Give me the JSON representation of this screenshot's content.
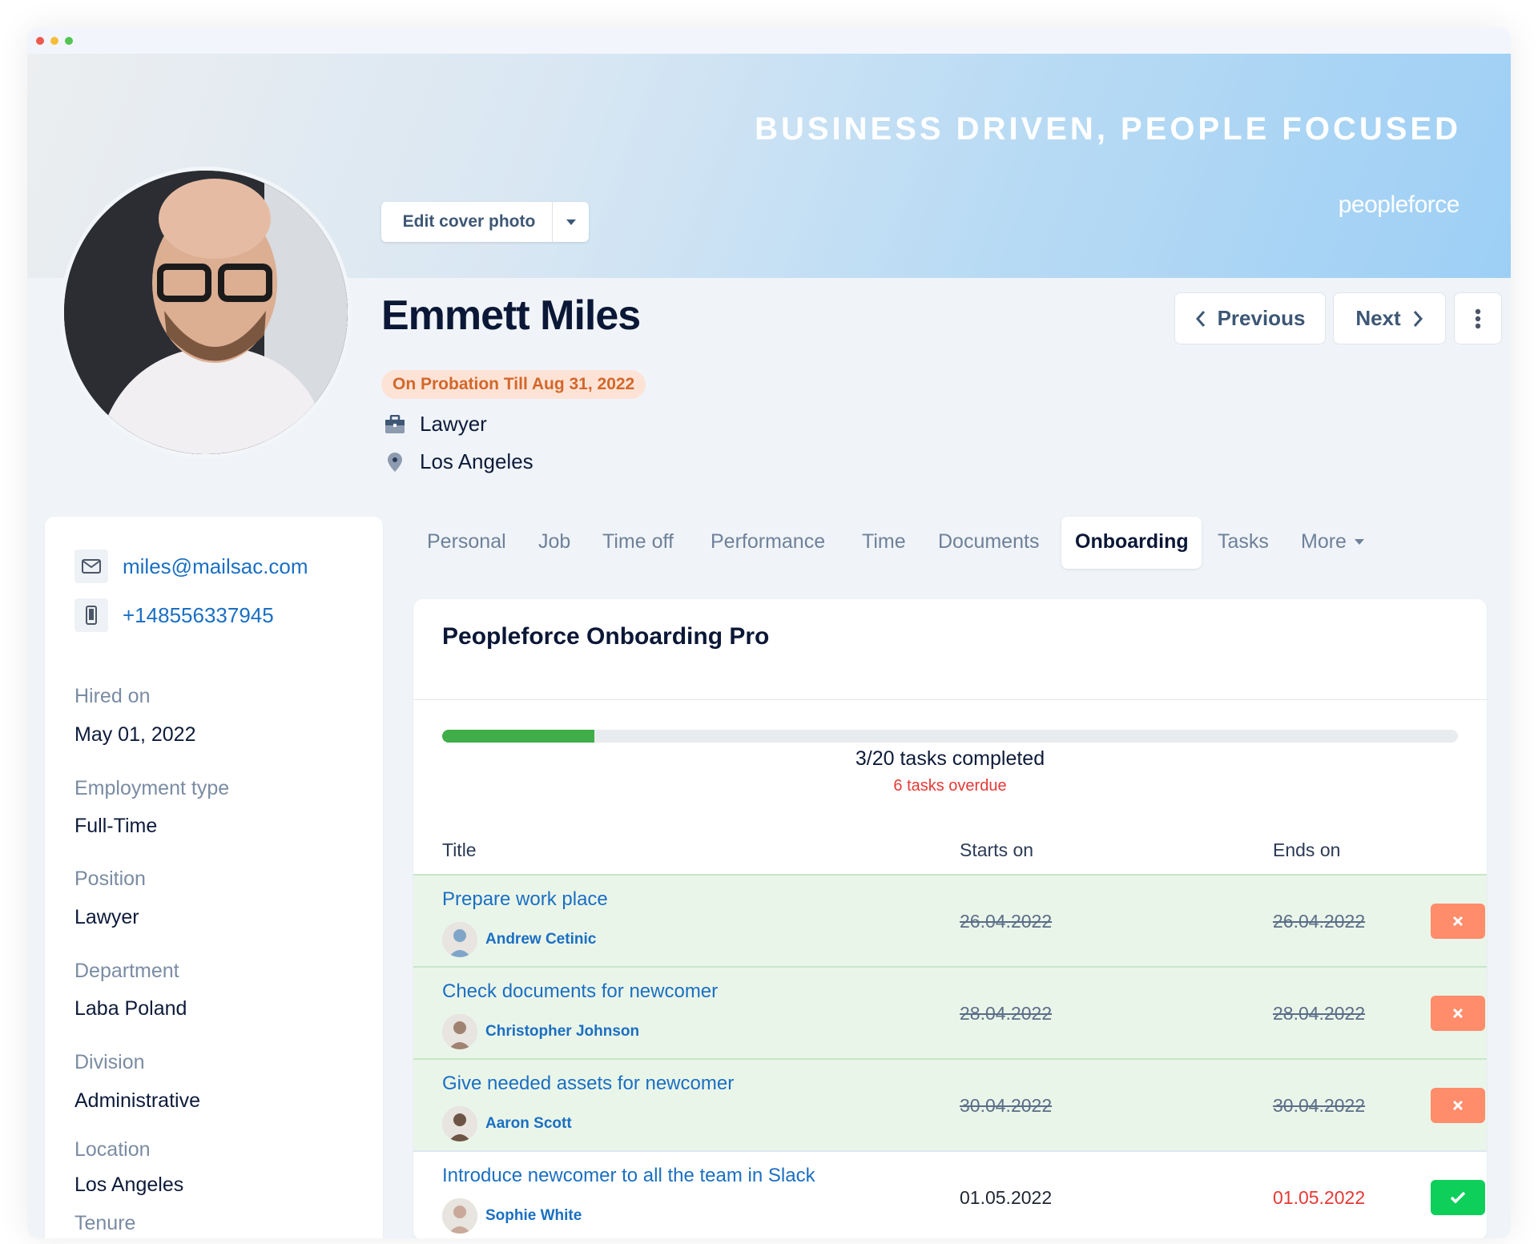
{
  "window": {
    "controls": [
      "close",
      "minimize",
      "maximize"
    ],
    "colors": {
      "close": "#ee5b4e",
      "minimize": "#f5bd3a",
      "maximize": "#54c453"
    }
  },
  "cover": {
    "tagline": "BUSINESS DRIVEN, PEOPLE FOCUSED",
    "logo": "peopleforce",
    "edit_label": "Edit cover photo"
  },
  "profile": {
    "name": "Emmett Miles",
    "status_badge": "On Probation Till Aug 31, 2022",
    "job_title": "Lawyer",
    "location": "Los Angeles"
  },
  "nav": {
    "previous": "Previous",
    "next": "Next"
  },
  "contact": {
    "email": "miles@mailsac.com",
    "phone": "+148556337945"
  },
  "details": [
    {
      "label": "Hired on",
      "value": "May 01, 2022"
    },
    {
      "label": "Employment type",
      "value": "Full-Time"
    },
    {
      "label": "Position",
      "value": "Lawyer"
    },
    {
      "label": "Department",
      "value": "Laba Poland"
    },
    {
      "label": "Division",
      "value": "Administrative"
    },
    {
      "label": "Location",
      "value": "Los Angeles"
    },
    {
      "label": "Tenure",
      "value": ""
    }
  ],
  "tabs": [
    "Personal",
    "Job",
    "Time off",
    "Performance",
    "Time",
    "Documents",
    "Onboarding",
    "Tasks",
    "More"
  ],
  "active_tab": "Onboarding",
  "onboarding": {
    "title": "Peopleforce Onboarding Pro",
    "progress_percent": 15,
    "completed_text": "3/20 tasks completed",
    "overdue_text": "6 tasks overdue",
    "columns": [
      "Title",
      "Starts on",
      "Ends on"
    ],
    "tasks": [
      {
        "title": "Prepare work place",
        "assignee": "Andrew Cetinic",
        "starts": "26.04.2022",
        "ends": "26.04.2022",
        "status": "done",
        "action_icon": "x-icon"
      },
      {
        "title": "Check documents for newcomer",
        "assignee": "Christopher Johnson",
        "starts": "28.04.2022",
        "ends": "28.04.2022",
        "status": "done",
        "action_icon": "x-icon"
      },
      {
        "title": "Give needed assets for newcomer",
        "assignee": "Aaron Scott",
        "starts": "30.04.2022",
        "ends": "30.04.2022",
        "status": "done",
        "action_icon": "x-icon"
      },
      {
        "title": "Introduce newcomer to all the team in Slack",
        "assignee": "Sophie White",
        "starts": "01.05.2022",
        "ends": "01.05.2022",
        "status": "overdue",
        "action_icon": "check-icon"
      }
    ]
  },
  "colors": {
    "link": "#1a6fc2",
    "progress": "#3fae49",
    "overdue": "#e53935",
    "undo_button": "#ff8c6b",
    "complete_button": "#0fcf5b",
    "done_row": "#eaf5e9"
  }
}
